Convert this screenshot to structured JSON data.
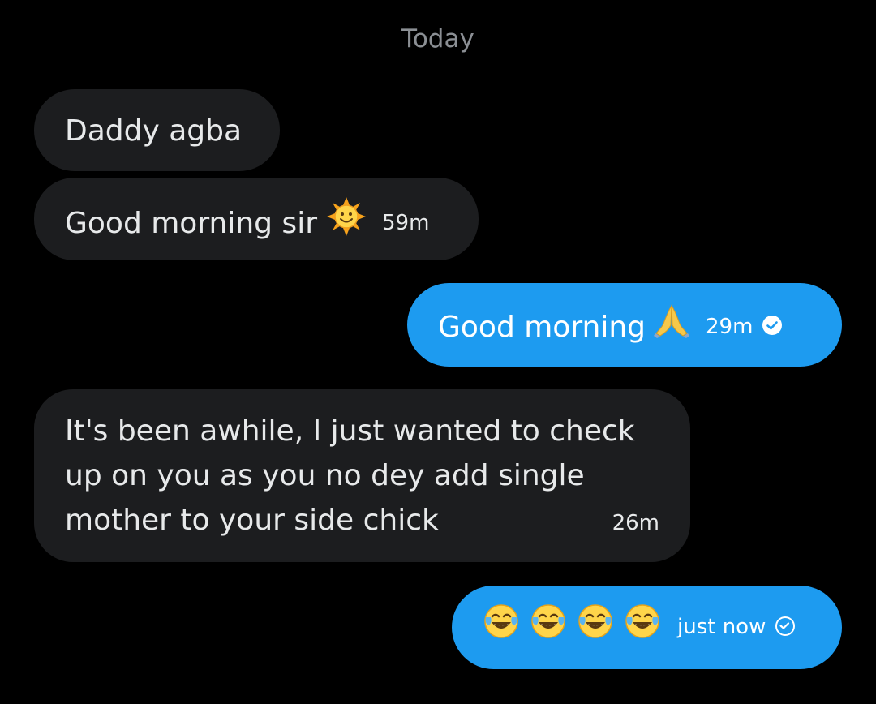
{
  "date_separator": "Today",
  "messages": [
    {
      "text": "Daddy agba",
      "time": ""
    },
    {
      "text": "Good morning sir",
      "time": "59m",
      "emoji": "sun-with-face"
    },
    {
      "text": "Good morning",
      "time": "29m",
      "emoji": "folded-hands",
      "status": "read"
    },
    {
      "lines": [
        "It's been awhile, I just wanted to check",
        "up on you as you no dey add single",
        "mother to your side chick"
      ],
      "time": "26m"
    },
    {
      "text": "",
      "time": "just now",
      "emoji": "face-with-tears-of-joy",
      "emoji_count": 4,
      "status": "sent"
    }
  ],
  "colors": {
    "background": "#000000",
    "incoming_bubble": "#1c1d1f",
    "outgoing_bubble": "#1d9bf0",
    "timestamp_separator": "#8b8f94"
  }
}
